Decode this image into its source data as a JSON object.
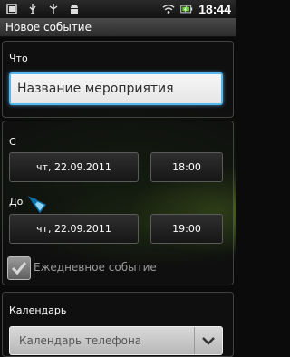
{
  "status_bar": {
    "time": "18:44",
    "left_icons": [
      "notification-square-icon",
      "usb-icon",
      "usb-debug-icon",
      "android-icon"
    ],
    "right_icons": [
      "wifi-icon",
      "battery-icon"
    ]
  },
  "header": {
    "title": "Новое событие"
  },
  "what": {
    "label": "Что",
    "input_value": "Название мероприятия"
  },
  "from": {
    "label": "С",
    "date": "чт, 22.09.2011",
    "time": "18:00"
  },
  "to": {
    "label": "До",
    "date": "чт, 22.09.2011",
    "time": "19:00"
  },
  "all_day": {
    "label": "Ежедневное событие",
    "checked": true
  },
  "calendar": {
    "label": "Календарь",
    "selected": "Календарь телефона"
  },
  "colors": {
    "focus_border": "#59b7f0",
    "header_bg": "#3a3a3a",
    "background_green": "#4a7a1a"
  }
}
